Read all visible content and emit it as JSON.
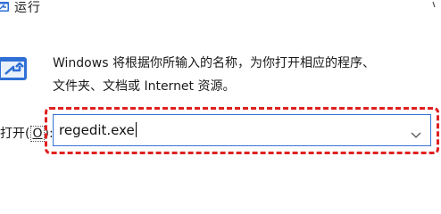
{
  "window": {
    "title": "运行",
    "title_icon": "run-icon",
    "close_icon": "close-icon"
  },
  "main": {
    "icon": "run-dialog-icon",
    "description_line1": "Windows 将根据你所输入的名称，为你打开相应的程序、",
    "description_line2": "文件夹、文档或 Internet 资源。",
    "open_label": "打开(",
    "open_hotkey": "O",
    "open_label_end": "):",
    "open_value": "regedit.exe",
    "dropdown_icon": "chevron-down-icon"
  },
  "colors": {
    "highlight": "#e02020",
    "input_border": "#3574d4",
    "icon_blue": "#2f6fd6"
  }
}
